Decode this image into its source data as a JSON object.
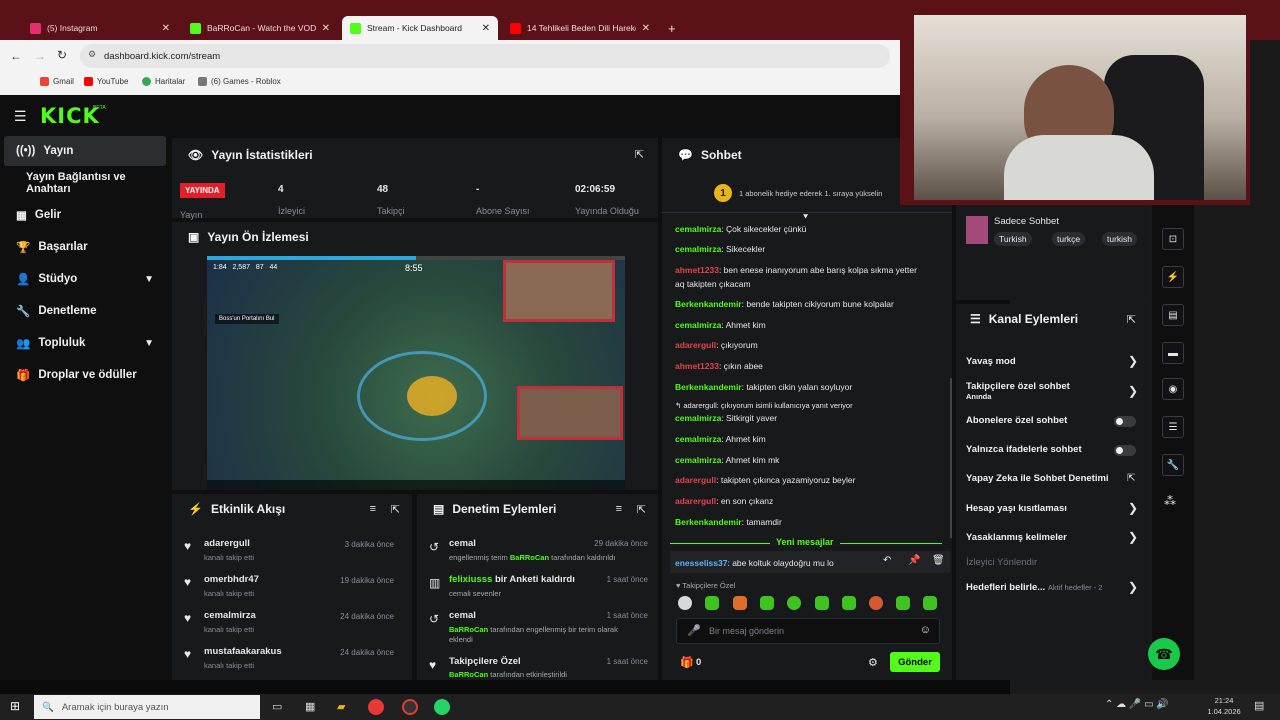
{
  "browser": {
    "tabs": [
      {
        "label": "(5) Instagram",
        "color": "#e1306c"
      },
      {
        "label": "BaRRoCan - Watch the VOD on",
        "color": "#53fc18"
      },
      {
        "label": "Stream - Kick Dashboard",
        "color": "#53fc18"
      },
      {
        "label": "14 Tehlikeli Beden Dili Hareketi",
        "color": "#ff0000"
      }
    ],
    "url": "dashboard.kick.com/stream",
    "bookmarks": [
      "Gmail",
      "YouTube",
      "Haritalar",
      "(6) Games - Roblox"
    ]
  },
  "logo": "KICK",
  "logo_badge": "BETA",
  "sidebar": {
    "items": [
      {
        "label": "Yayın",
        "icon": "broadcast-icon"
      },
      {
        "label": "Yayın Bağlantısı ve Anahtarı",
        "icon": ""
      },
      {
        "label": "Gelir",
        "icon": "grid-icon"
      },
      {
        "label": "Başarılar",
        "icon": "trophy-icon"
      },
      {
        "label": "Stüdyo",
        "icon": "person-icon"
      },
      {
        "label": "Denetleme",
        "icon": "wrench-icon"
      },
      {
        "label": "Topluluk",
        "icon": "community-icon"
      },
      {
        "label": "Droplar ve ödüller",
        "icon": "gift-icon"
      }
    ]
  },
  "stats": {
    "title": "Yayın İstatistikleri",
    "live_badge": "YAYINDA",
    "live_label": "Yayın",
    "items": [
      {
        "value": "4",
        "label": "İzleyici"
      },
      {
        "value": "48",
        "label": "Takipçi"
      },
      {
        "value": "-",
        "label": "Abone Sayısı"
      },
      {
        "value": "02:06:59",
        "label": "Yayında Olduğu"
      }
    ]
  },
  "preview": {
    "title": "Yayın Ön İzlemesi",
    "game_timer": "8:55",
    "game_hud": [
      "1:84",
      "2,587",
      "87",
      "44"
    ],
    "game_quest": "Boss'un Portalını Bul",
    "progress": 0.5
  },
  "feed": {
    "title": "Etkinlik Akışı",
    "items": [
      {
        "user": "adarergull",
        "sub": "kanalı takip etti",
        "time": "3 dakika önce"
      },
      {
        "user": "omerbhdr47",
        "sub": "kanalı takip etti",
        "time": "19 dakika önce"
      },
      {
        "user": "cemalmirza",
        "sub": "kanalı takip etti",
        "time": "24 dakika önce"
      },
      {
        "user": "mustafaakarakus",
        "sub": "kanalı takip etti",
        "time": "24 dakika önce"
      }
    ]
  },
  "modlog": {
    "title": "Denetim Eylemleri",
    "items": [
      {
        "title": "cemal",
        "line1a": "engellenmiş terim ",
        "line1b": "BaRRoCan",
        "line1c": " tarafından kaldırıldı",
        "line2": "",
        "time": "29 dakika önce"
      },
      {
        "title_a": "felixiusss",
        "title_b": " bir Anketi kaldırdı",
        "line1a": "cemali sevenler",
        "time": "1 saat önce"
      },
      {
        "title": "cemal",
        "line1b": "BaRRoCan",
        "line1c": " tarafından engellenmiş bir terim olarak",
        "line2": "eklendi",
        "time": "1 saat önce"
      },
      {
        "title": "Takipçilere Özel",
        "line1b": "BaRRoCan",
        "line1c": " tarafından etkinleştirildi",
        "time": "1 saat önce"
      }
    ]
  },
  "chat": {
    "title": "Sohbet",
    "pinned": "1 abonelik hediye ederek 1. sıraya yükselin",
    "pinned_rank": "1",
    "messages": [
      {
        "user": "cemalmirza",
        "text": ": Çok sikecekler çünkü",
        "kind": "green"
      },
      {
        "user": "cemalmirza",
        "text": ": Sikecekler",
        "kind": "green"
      },
      {
        "user": "ahmet1233",
        "text": ": ben enese inanıyorum abe barış kolpa sıkma yetter",
        "text2": "aq takipten çıkacam",
        "kind": "red"
      },
      {
        "user": "Berkenkandemir",
        "text": ": bende takipten cikiyorum bune kolpalar",
        "kind": "green"
      },
      {
        "user": "cemalmirza",
        "text": ": Ahmet kim",
        "kind": "green"
      },
      {
        "user": "adarergull",
        "text": ": çıkıyorum",
        "kind": "red"
      },
      {
        "user": "ahmet1233",
        "text": ": çıkın abee",
        "kind": "red"
      },
      {
        "user": "Berkenkandemir",
        "text": ": takipten cikin yalan soyluyor",
        "kind": "green"
      },
      {
        "user": "cemalmirza",
        "text": ": Sitkirgit yaver",
        "kind": "green",
        "reply": "adarergull: çıkıyorum isimli kullanıcıya yanıt veriyor"
      },
      {
        "user": "cemalmirza",
        "text": ": Ahmet kim",
        "kind": "green"
      },
      {
        "user": "cemalmirza",
        "text": ": Ahmet kim mk",
        "kind": "green"
      },
      {
        "user": "adarergull",
        "text": ": takipten çıkınca yazamiyoruz beyler",
        "kind": "red"
      },
      {
        "user": "adarergull",
        "text": ": en son çıkanz",
        "kind": "red"
      },
      {
        "user": "Berkenkandemir",
        "text": ": tamamdir",
        "kind": "green"
      }
    ],
    "new_messages": "Yeni mesajlar",
    "last": {
      "user": "enesseliss37",
      "text": ": abe koltuk olaydoğru mu lo"
    },
    "followers_only": "Takipçilere Özel",
    "placeholder": "Bir mesaj gönderin",
    "count": "0",
    "send": "Gönder"
  },
  "right": {
    "mode_label": "Sadece Sohbet",
    "tags": [
      "Turkish",
      "turkçe",
      "turkish"
    ],
    "actions_title": "Kanal Eylemleri",
    "actions": [
      {
        "label": "Yavaş mod",
        "type": "chevron"
      },
      {
        "label": "Takipçilere özel sohbet",
        "sub": "Anında",
        "type": "chevron"
      },
      {
        "label": "Abonelere özel sohbet",
        "type": "toggle"
      },
      {
        "label": "Yalnızca ifadelerle sohbet",
        "type": "toggle"
      },
      {
        "label": "Yapay Zeka ile Sohbet Denetimi",
        "type": "external"
      },
      {
        "label": "Hesap yaşı kısıtlaması",
        "type": "chevron"
      },
      {
        "label": "Yasaklanmış kelimeler",
        "type": "chevron"
      },
      {
        "label": "İzleyici Yönlendir",
        "type": "disabled"
      },
      {
        "label": "Hedefleri belirle...",
        "sub": "Aktif hedefler - 2",
        "type": "chevron"
      }
    ]
  },
  "taskbar": {
    "search": "Aramak için buraya yazın",
    "time": "21:24",
    "date": "1.04.2026"
  }
}
